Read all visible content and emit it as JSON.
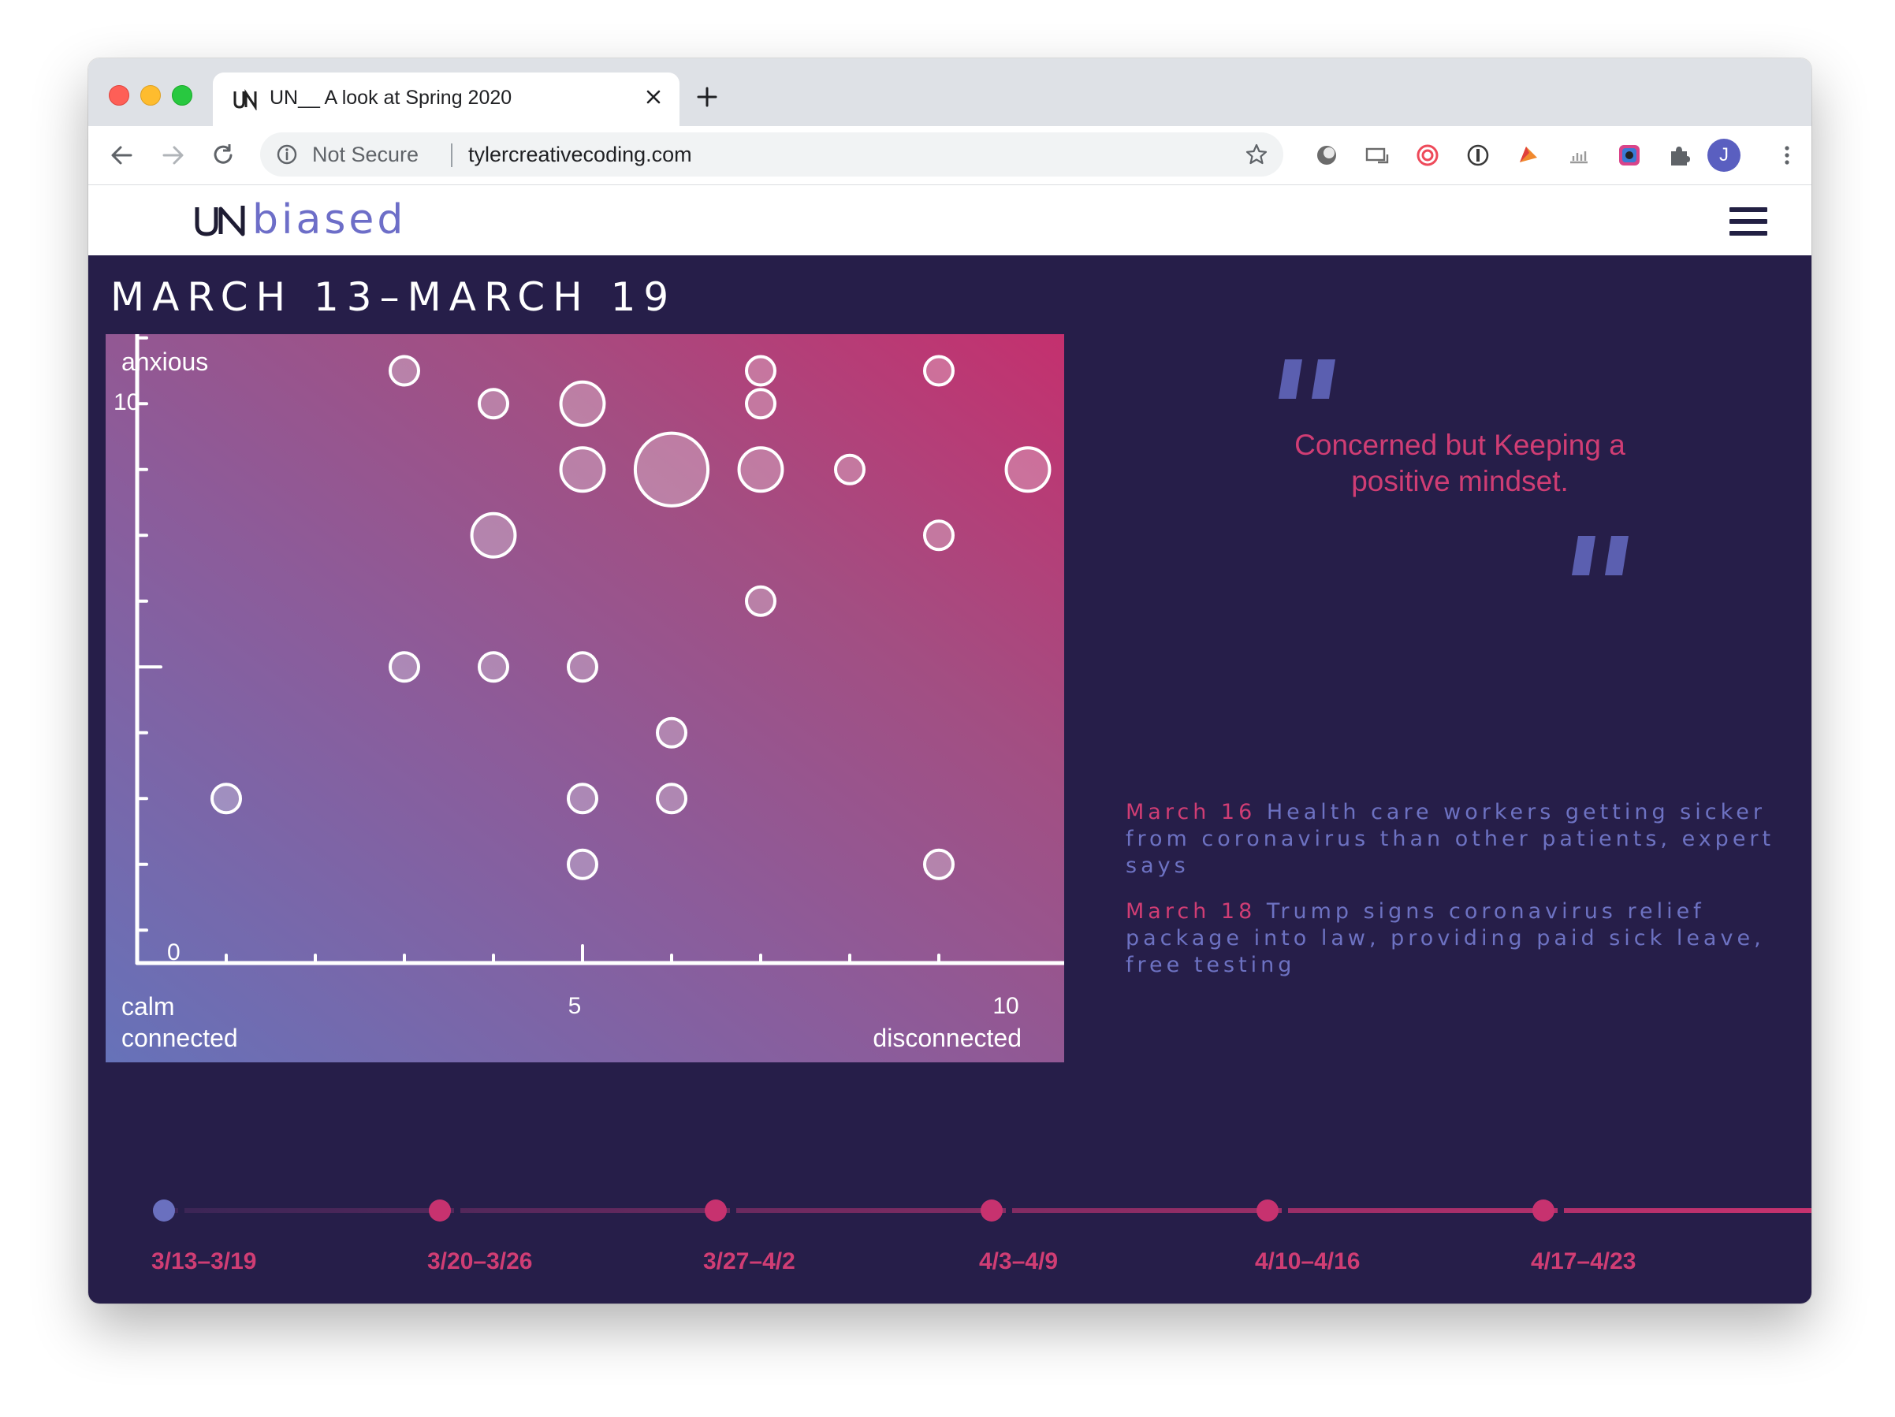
{
  "browser": {
    "tab_title": "UN__ A look at Spring 2020",
    "security_label": "Not Secure",
    "url": "tylercreativecoding.com",
    "profile_initial": "J"
  },
  "site": {
    "logo_text": "biased"
  },
  "page": {
    "week_title": "MARCH 13–MARCH 19",
    "quote": "Concerned but Keeping a positive mindset.",
    "headlines": [
      {
        "date": "March 16",
        "text": " Health care workers getting sicker from coronavirus than other patients, expert says"
      },
      {
        "date": "March 18",
        "text": " Trump signs coronavirus relief package into law, providing paid sick leave, free testing"
      }
    ],
    "timeline": [
      {
        "label": "3/13–3/19",
        "active": true
      },
      {
        "label": "3/20–3/26",
        "active": false
      },
      {
        "label": "3/27–4/2",
        "active": false
      },
      {
        "label": "4/3–4/9",
        "active": false
      },
      {
        "label": "4/10–4/16",
        "active": false
      },
      {
        "label": "4/17–4/23",
        "active": false
      }
    ]
  },
  "chart_data": {
    "type": "scatter",
    "y_top_label": "anxious",
    "y_tick_top": "10",
    "y_tick_bottom": "0",
    "x_left_label_1": "calm",
    "x_left_label_2": "connected",
    "x_tick_mid": "5",
    "x_tick_right": "10",
    "x_right_label": "disconnected",
    "xlim": [
      0,
      10
    ],
    "ylim": [
      0,
      10
    ],
    "points": [
      {
        "x": 3,
        "y": 9,
        "size": 1
      },
      {
        "x": 4,
        "y": 8.5,
        "size": 1
      },
      {
        "x": 5,
        "y": 8.5,
        "size": 2
      },
      {
        "x": 7,
        "y": 9,
        "size": 1
      },
      {
        "x": 7,
        "y": 8.5,
        "size": 1
      },
      {
        "x": 9,
        "y": 9,
        "size": 1
      },
      {
        "x": 5,
        "y": 7.5,
        "size": 2
      },
      {
        "x": 6,
        "y": 7.5,
        "size": 6
      },
      {
        "x": 7,
        "y": 7.5,
        "size": 2
      },
      {
        "x": 8,
        "y": 7.5,
        "size": 1
      },
      {
        "x": 10,
        "y": 7.5,
        "size": 2
      },
      {
        "x": 4,
        "y": 6.5,
        "size": 2
      },
      {
        "x": 9,
        "y": 6.5,
        "size": 1
      },
      {
        "x": 7,
        "y": 5.5,
        "size": 1
      },
      {
        "x": 3,
        "y": 4.5,
        "size": 1
      },
      {
        "x": 4,
        "y": 4.5,
        "size": 1
      },
      {
        "x": 5,
        "y": 4.5,
        "size": 1
      },
      {
        "x": 6,
        "y": 3.5,
        "size": 1
      },
      {
        "x": 1,
        "y": 2.5,
        "size": 1
      },
      {
        "x": 5,
        "y": 2.5,
        "size": 1
      },
      {
        "x": 6,
        "y": 2.5,
        "size": 1
      },
      {
        "x": 5,
        "y": 1.5,
        "size": 1
      },
      {
        "x": 9,
        "y": 1.5,
        "size": 1
      }
    ]
  }
}
